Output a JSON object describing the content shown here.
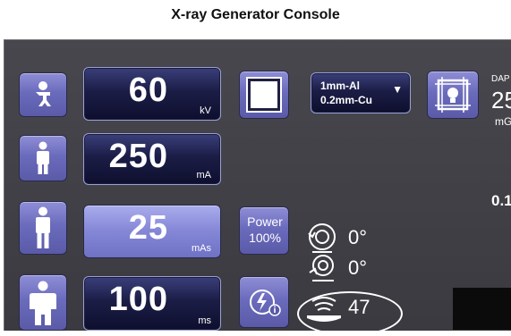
{
  "title": "X-ray Generator Console",
  "kv": {
    "value": "60",
    "unit": "kV"
  },
  "ma": {
    "value": "250",
    "unit": "mA"
  },
  "mas": {
    "value": "25",
    "unit": "mAs"
  },
  "ms": {
    "value": "100",
    "unit": "ms"
  },
  "filter": {
    "line1": "1mm-Al",
    "line2": "0.2mm-Cu",
    "dropdown_glyph": "▼"
  },
  "power": {
    "line1": "Power",
    "line2": "100%"
  },
  "readouts": {
    "rotation": "0°",
    "tilt": "0°",
    "sid": "47"
  },
  "dap": {
    "label": "DAP",
    "value": "25",
    "unit": "mG",
    "secondary": "0.1"
  },
  "icons": [
    "patient-child-icon",
    "patient-small-icon",
    "patient-medium-icon",
    "patient-large-icon",
    "stop-square-icon",
    "collimator-light-icon",
    "power-info-icon",
    "rotation-icon",
    "tilt-icon",
    "sid-icon"
  ],
  "colors": {
    "background": "#3f3f45",
    "tile_accent": "#7678c8",
    "value_box": "#14163a"
  }
}
